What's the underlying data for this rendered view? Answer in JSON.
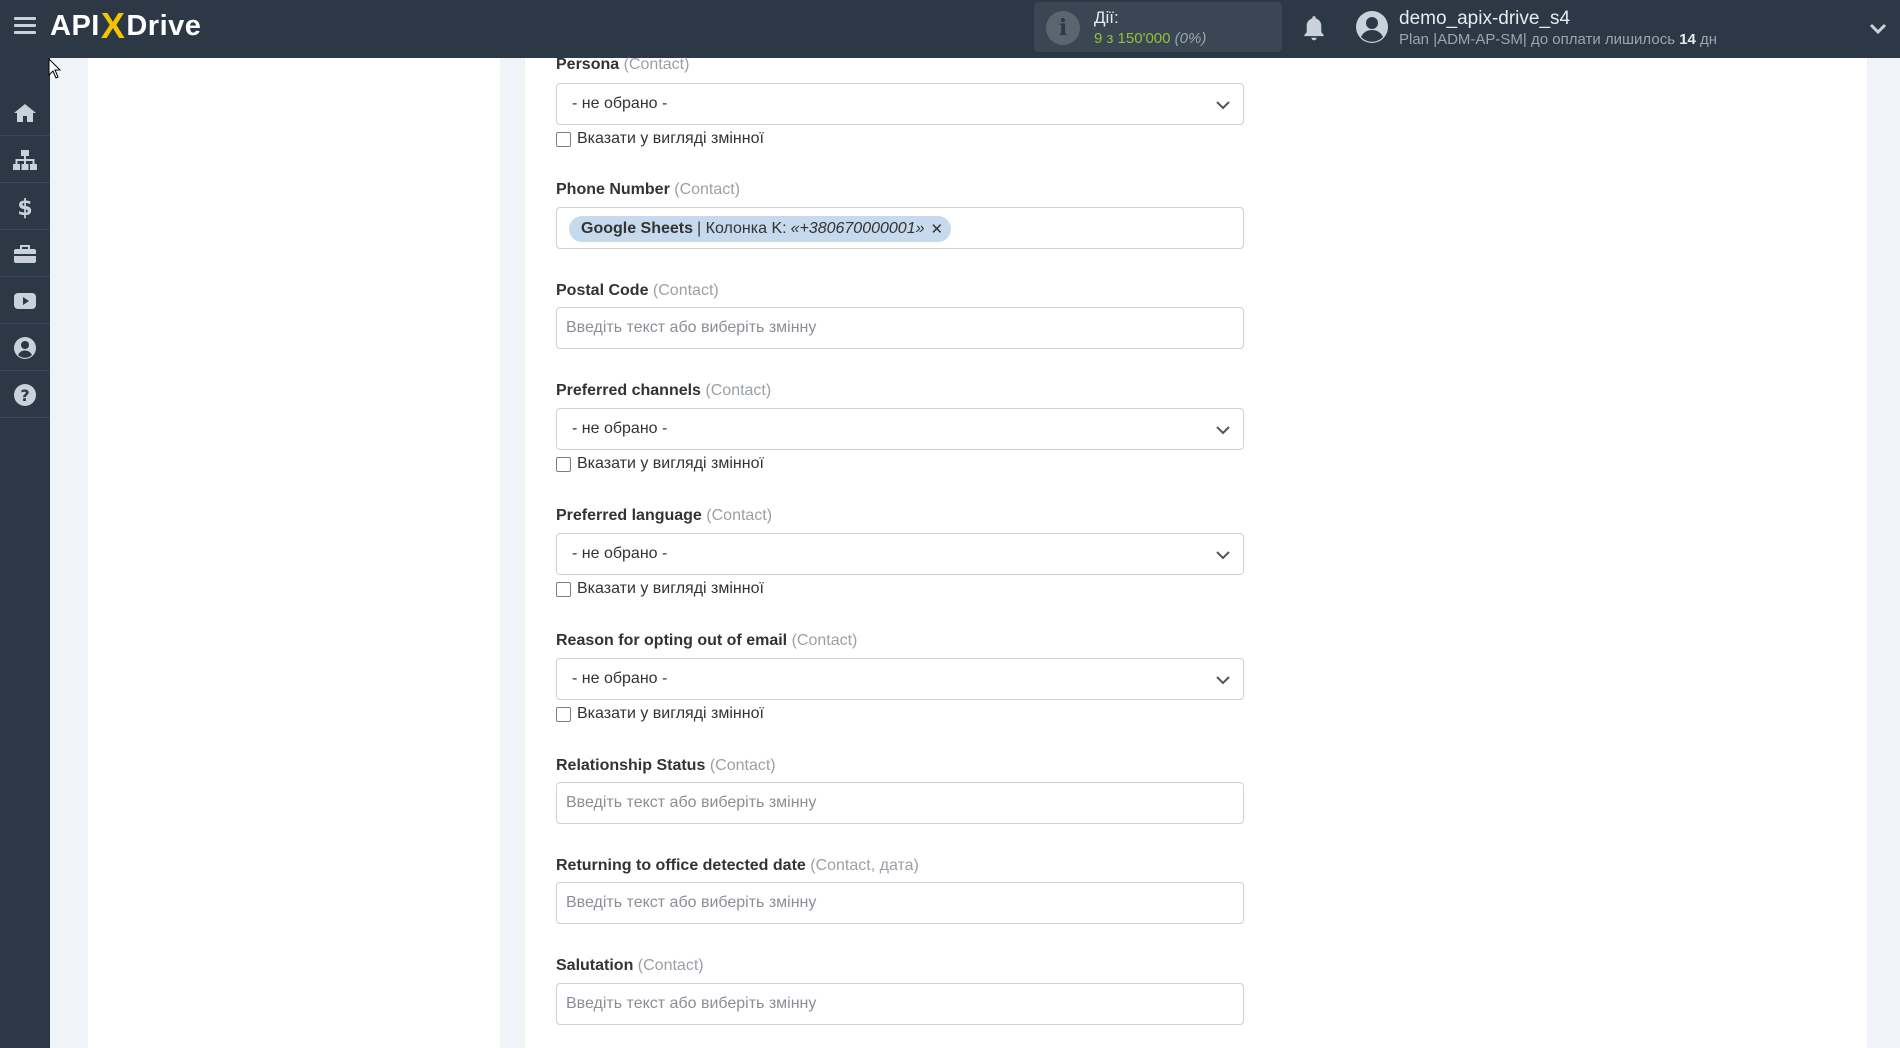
{
  "header": {
    "logo_api": "API",
    "logo_x": "X",
    "logo_drive": "Drive",
    "actions_title": "Дії:",
    "actions_count": "9 з 150'000",
    "actions_percent": "(0%)",
    "user_name": "demo_apix-drive_s4",
    "plan_prefix": "Plan |ADM-AP-SM| до оплати лишилось",
    "plan_days": "14",
    "plan_suffix": "дн"
  },
  "sidebar": {
    "items": [
      {
        "icon": "home-icon"
      },
      {
        "icon": "sitemap-icon"
      },
      {
        "icon": "dollar-icon"
      },
      {
        "icon": "briefcase-icon"
      },
      {
        "icon": "youtube-icon"
      },
      {
        "icon": "user-circle-icon"
      },
      {
        "icon": "help-icon"
      }
    ]
  },
  "common": {
    "not_selected": "- не обрано -",
    "as_variable": "Вказати у вигляді змінної",
    "placeholder": "Введіть текст або виберіть змінну"
  },
  "fields": {
    "persona": {
      "label": "Persona",
      "sub": "(Contact)"
    },
    "phone": {
      "label": "Phone Number",
      "sub": "(Contact)",
      "tag_source": "Google Sheets",
      "tag_column": "| Колонка K:",
      "tag_value": "«+380670000001»",
      "tag_remove": "✕"
    },
    "postal": {
      "label": "Postal Code",
      "sub": "(Contact)"
    },
    "pref_channels": {
      "label": "Preferred channels",
      "sub": "(Contact)"
    },
    "pref_language": {
      "label": "Preferred language",
      "sub": "(Contact)"
    },
    "opt_out_reason": {
      "label": "Reason for opting out of email",
      "sub": "(Contact)"
    },
    "relationship": {
      "label": "Relationship Status",
      "sub": "(Contact)"
    },
    "returning_office": {
      "label": "Returning to office detected date",
      "sub": "(Contact, дата)"
    },
    "salutation": {
      "label": "Salutation",
      "sub": "(Contact)"
    }
  }
}
